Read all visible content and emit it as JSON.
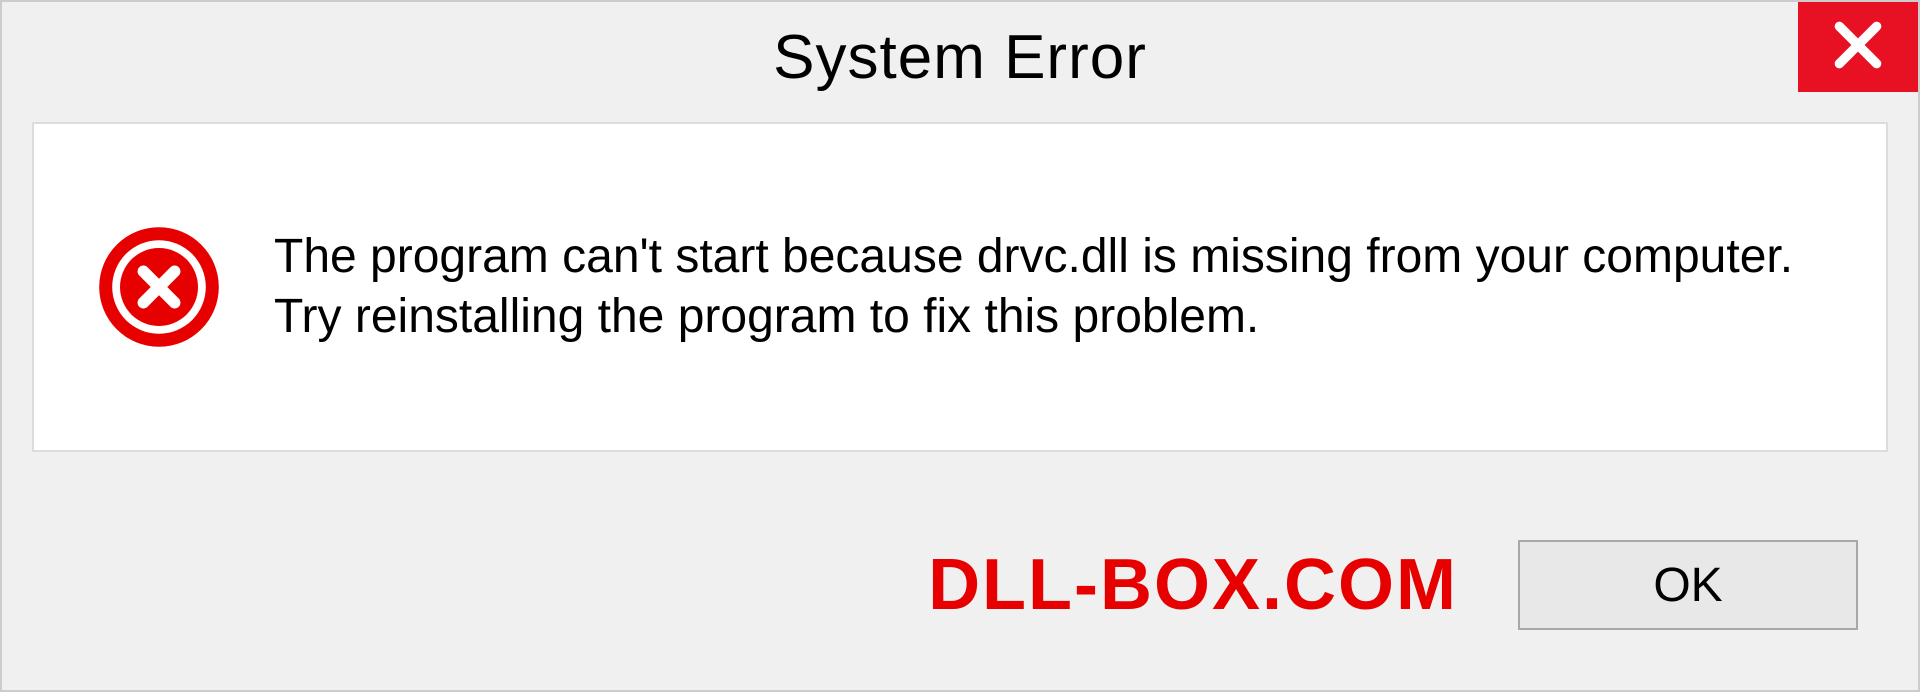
{
  "titlebar": {
    "title": "System Error"
  },
  "dialog": {
    "message": "The program can't start because drvc.dll is missing from your computer. Try reinstalling the program to fix this problem."
  },
  "footer": {
    "watermark": "DLL-BOX.COM",
    "ok_label": "OK"
  },
  "colors": {
    "close_bg": "#e81123",
    "error_red": "#e60000",
    "panel_bg": "#ffffff",
    "body_bg": "#f0f0f0"
  }
}
